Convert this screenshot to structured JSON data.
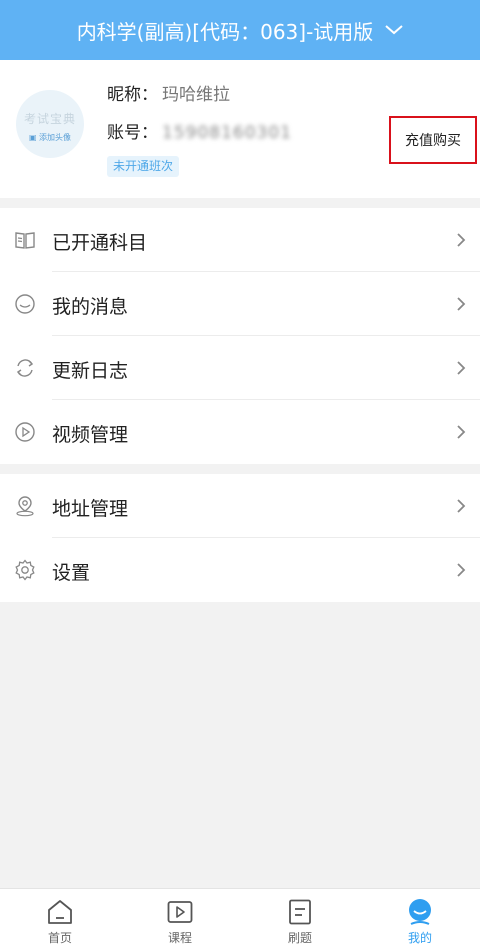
{
  "header": {
    "title": "内科学(副高)[代码：063]-试用版",
    "chevron_icon": "chevron-down-icon"
  },
  "profile": {
    "avatar_logo": "考试宝典",
    "avatar_add": "添加头像",
    "nickname_label": "昵称：",
    "nickname": "玛哈维拉",
    "account_label": "账号：",
    "account": "15908160301",
    "badge": "未开通班次",
    "buy_button": "充值购买"
  },
  "menu_group1": [
    {
      "label": "已开通科目",
      "icon": "book-icon"
    },
    {
      "label": "我的消息",
      "icon": "message-icon"
    },
    {
      "label": "更新日志",
      "icon": "refresh-icon"
    },
    {
      "label": "视频管理",
      "icon": "play-circle-icon"
    }
  ],
  "menu_group2": [
    {
      "label": "地址管理",
      "icon": "location-icon"
    },
    {
      "label": "设置",
      "icon": "gear-icon"
    }
  ],
  "tabbar": [
    {
      "label": "首页",
      "icon": "home-icon"
    },
    {
      "label": "课程",
      "icon": "video-icon"
    },
    {
      "label": "刷题",
      "icon": "document-icon"
    },
    {
      "label": "我的",
      "icon": "profile-icon"
    }
  ],
  "colors": {
    "header_bg": "#5fb2f4",
    "active_tab": "#2f9ef0",
    "highlight_border": "#d9111b"
  }
}
